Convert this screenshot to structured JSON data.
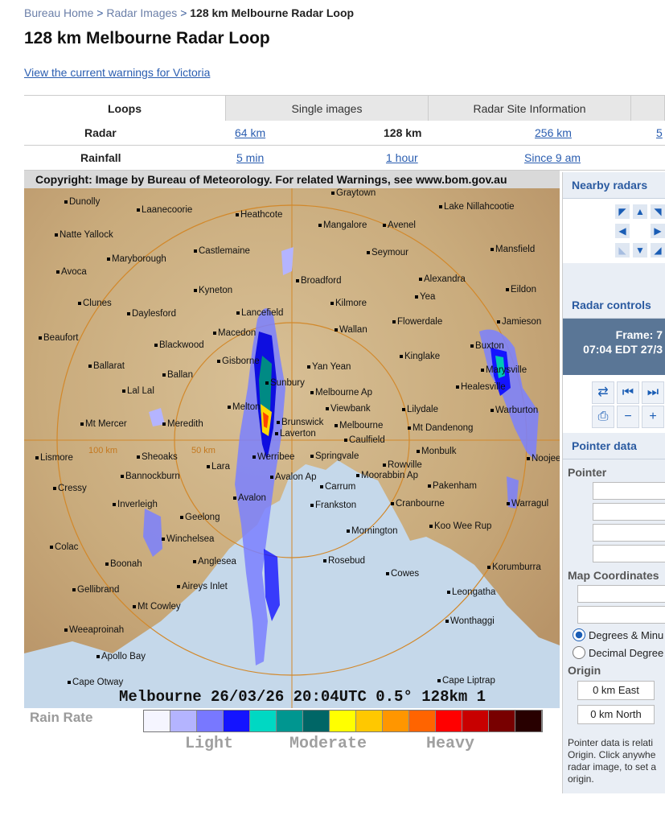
{
  "breadcrumb": {
    "home": "Bureau Home",
    "sep1": ">",
    "radar_images": "Radar Images",
    "sep2": ">",
    "current": "128 km Melbourne Radar Loop"
  },
  "page_title": "128 km Melbourne Radar Loop",
  "warnings_link": "View the current warnings for Victoria",
  "tabs": [
    "Loops",
    "Single images",
    "Radar Site Information",
    ""
  ],
  "radar_row": {
    "label": "Radar",
    "r64": "64 km",
    "r128": "128 km",
    "r256": "256 km",
    "r512": "5"
  },
  "rainfall_row": {
    "label": "Rainfall",
    "m5": "5 min",
    "h1": "1 hour",
    "since9": "Since 9 am"
  },
  "radar": {
    "copyright": "Copyright: Image by Bureau of Meteorology. For related Warnings, see www.bom.gov.au",
    "caption": "Melbourne 26/03/26 20:04UTC 0.5° 128km 1",
    "range_100": "100 km",
    "range_50": "50 km",
    "towns": [
      "Graytown",
      "Dunolly",
      "Laanecoorie",
      "Heathcote",
      "Mangalore",
      "Avenel",
      "Lake Nillahcootie",
      "Natte Yallock",
      "Maryborough",
      "Castlemaine",
      "Seymour",
      "Mansfield",
      "Avoca",
      "Broadford",
      "Alexandra",
      "Eildon",
      "Kyneton",
      "Clunes",
      "Daylesford",
      "Lancefield",
      "Kilmore",
      "Yea",
      "Jamieson",
      "Beaufort",
      "Macedon",
      "Flowerdale",
      "Wallan",
      "Blackwood",
      "Buxton",
      "Kinglake",
      "Ballarat",
      "Gisborne",
      "Yan Yean",
      "Marysville",
      "Ballan",
      "Sunbury",
      "Healesville",
      "Lal Lal",
      "Melbourne Ap",
      "Viewbank",
      "Lilydale",
      "Warburton",
      "Mt Mercer",
      "Meredith",
      "Melton",
      "Brunswick",
      "Melbourne",
      "Mt Dandenong",
      "Laverton",
      "Caulfield",
      "Lismore",
      "Sheoaks",
      "Werribee",
      "Springvale",
      "Monbulk",
      "Noojee",
      "Bannockburn",
      "Lara",
      "Rowville",
      "Moorabbin Ap",
      "Cressy",
      "Avalon Ap",
      "Carrum",
      "Pakenham",
      "Inverleigh",
      "Avalon",
      "Frankston",
      "Cranbourne",
      "Warragul",
      "Geelong",
      "Koo Wee Rup",
      "Mornington",
      "Winchelsea",
      "Colac",
      "Anglesea",
      "Rosebud",
      "Korumburra",
      "Boonah",
      "Cowes",
      "Gellibrand",
      "Aireys Inlet",
      "Leongatha",
      "Mt Cowley",
      "Wonthaggi",
      "Weeaproinah",
      "Apollo Bay",
      "Cape Otway",
      "Cape Liptrap"
    ]
  },
  "legend": {
    "title": "Rain Rate",
    "light": "Light",
    "moderate": "Moderate",
    "heavy": "Heavy",
    "colors": [
      "#f5f5ff",
      "#b4b4ff",
      "#7878ff",
      "#1414ff",
      "#00d8c3",
      "#009690",
      "#006666",
      "#ffff00",
      "#ffc800",
      "#ff9600",
      "#ff6400",
      "#ff0000",
      "#c80000",
      "#780000",
      "#280000"
    ]
  },
  "sidebar": {
    "nearby_title": "Nearby radars",
    "controls_title": "Radar controls",
    "frame_label": "Frame: 7",
    "frame_time": "07:04 EDT 27/3",
    "pointer_title": "Pointer data",
    "pointer_label": "Pointer",
    "map_coords_label": "Map Coordinates",
    "degrees_option": "Degrees & Minu",
    "decimal_option": "Decimal Degree",
    "origin_label": "Origin",
    "origin_east": "0 km East",
    "origin_north": "0 km North",
    "note": "Pointer data is relati Origin. Click anywhe radar image, to set a origin."
  }
}
